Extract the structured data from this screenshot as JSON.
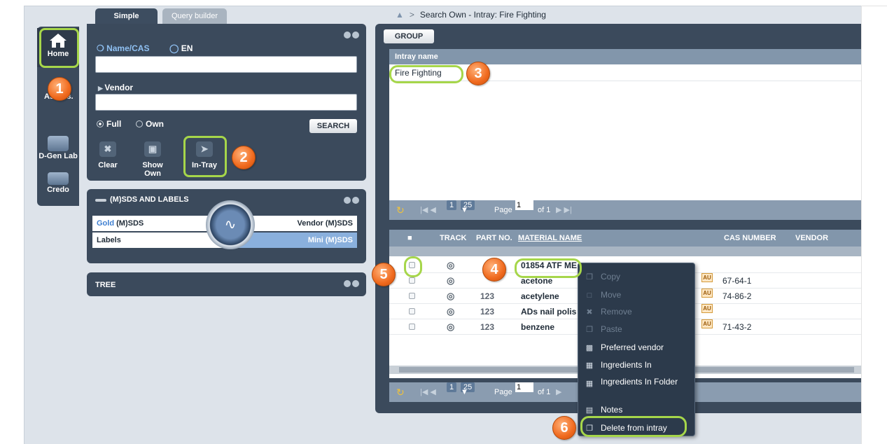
{
  "left_nav": {
    "items": [
      {
        "label": "Home",
        "icon": "home-icon"
      },
      {
        "label": "Risk Assess.",
        "icon": "risk-icon"
      },
      {
        "label": "D-Gen Lab",
        "icon": "dgen-lab-icon"
      },
      {
        "label": "Credo",
        "icon": "credo-handshake-icon"
      }
    ]
  },
  "search_panel": {
    "tabs": [
      "Simple",
      "Query builder"
    ],
    "name_cas_label": "Name/CAS",
    "lang_label": "EN",
    "vendor_label": "Vendor",
    "scope_options": [
      "Full",
      "Own"
    ],
    "selected_scope": "Full",
    "search_button": "SEARCH",
    "tools": [
      "Clear",
      "Show Own",
      "In-Tray"
    ]
  },
  "msds_panel": {
    "title": "(M)SDS AND LABELS",
    "row1_left_prefix": "Gold",
    "row1_left_suffix": "(M)SDS",
    "row1_right": "Vendor (M)SDS",
    "row2_left": "Labels",
    "row2_right": "Mini (M)SDS"
  },
  "tree_panel": {
    "title": "TREE"
  },
  "breadcrumb": {
    "text": "Search Own - Intray: Fire Fighting",
    "separator": ">"
  },
  "main": {
    "group_button": "GROUP",
    "intray_header": "Intray name",
    "intray_rows": [
      "Fire Fighting"
    ],
    "pager": {
      "page_num": "1",
      "page_size": "25",
      "page_label": "Page",
      "page_value": "1",
      "of_label": "of 1"
    },
    "grid_headers": [
      "TRACK",
      "PART NO.",
      "MATERIAL NAME",
      "CAS NUMBER",
      "VENDOR"
    ],
    "rows": [
      {
        "name": "01854 ATF ME",
        "part": "",
        "cas": "",
        "au": false
      },
      {
        "name": "acetone",
        "part": "",
        "cas": "67-64-1",
        "au": true
      },
      {
        "name": "acetylene",
        "part": "123",
        "cas": "74-86-2",
        "au": true
      },
      {
        "name": "ADs nail polis",
        "part": "123",
        "cas": "",
        "au": true
      },
      {
        "name": "benzene",
        "part": "123",
        "cas": "71-43-2",
        "au": true
      }
    ],
    "au_label": "AU"
  },
  "context_menu": {
    "items": [
      {
        "label": "Copy",
        "disabled": true,
        "icon": "copy-icon"
      },
      {
        "label": "Move",
        "disabled": true,
        "icon": "move-icon"
      },
      {
        "label": "Remove",
        "disabled": true,
        "icon": "remove-icon"
      },
      {
        "label": "Paste",
        "disabled": true,
        "icon": "paste-icon"
      },
      {
        "label": "Preferred vendor",
        "disabled": false,
        "icon": "factory-icon"
      },
      {
        "label": "Ingredients In",
        "disabled": false,
        "icon": "ingredients-icon"
      },
      {
        "label": "Ingredients In Folder",
        "disabled": false,
        "icon": "ingredients-folder-icon"
      },
      {
        "label": "Notes",
        "disabled": false,
        "icon": "notes-icon"
      },
      {
        "label": "Delete from intray",
        "disabled": false,
        "icon": "delete-copy-icon"
      }
    ]
  },
  "callouts": [
    "1",
    "2",
    "3",
    "4",
    "5",
    "6"
  ],
  "colors": {
    "accent": "#a6d64a",
    "badge": "#f06a1e",
    "panel": "#3b4a5c"
  }
}
